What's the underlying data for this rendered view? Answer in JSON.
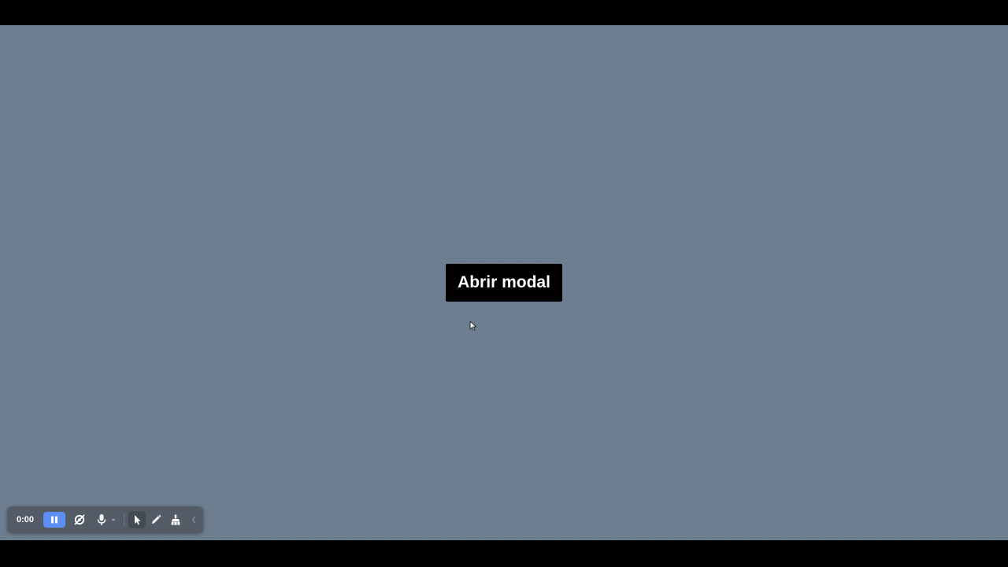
{
  "page": {
    "open_modal_button_label": "Abrir modal"
  },
  "recorder_toolbar": {
    "timer": "0:00",
    "pause_color": "#5b8ff5",
    "icons": [
      "pause-icon",
      "camera-off-icon",
      "microphone-icon",
      "chevron-down-icon",
      "pointer-tool-icon",
      "pen-tool-icon",
      "eraser-tool-icon",
      "collapse-chevron-icon"
    ]
  },
  "colors": {
    "background": "#6c7d8f",
    "button_bg": "#000000",
    "button_text": "#ffffff",
    "toolbar_bg": "#535b66"
  }
}
